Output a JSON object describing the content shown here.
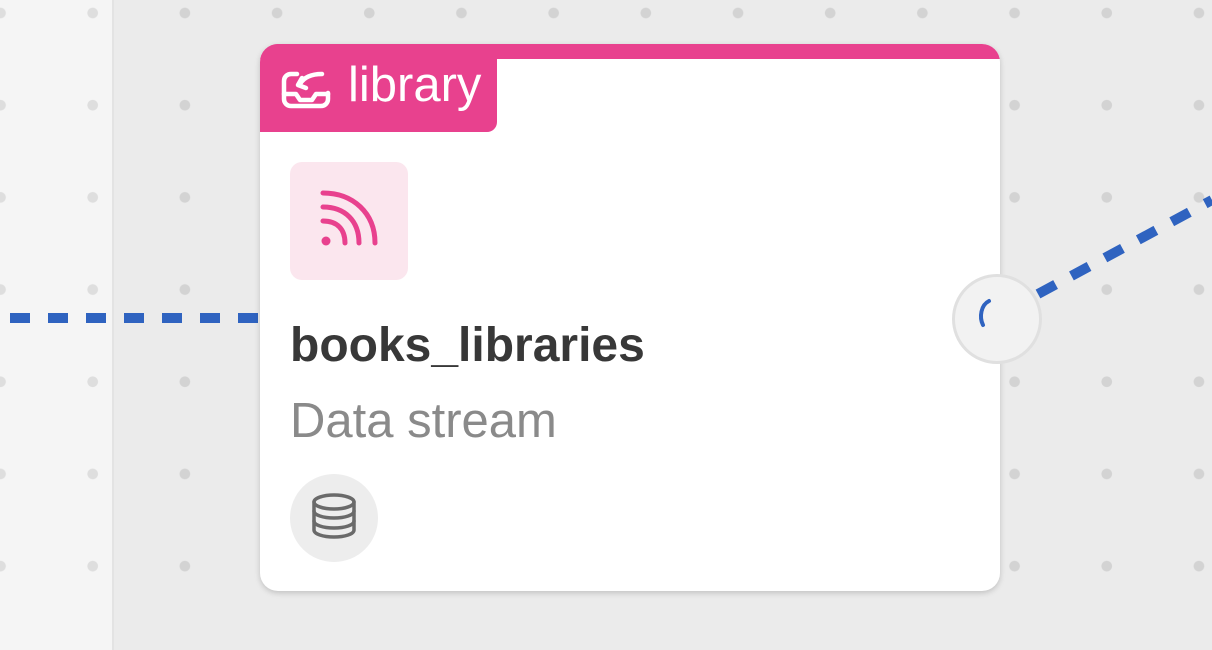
{
  "node": {
    "type_label": "library",
    "type_icon": "import-tray-icon",
    "source_icon": "rss-feed-icon",
    "title": "books_libraries",
    "subtitle": "Data stream",
    "storage_icon": "database-icon",
    "status_icon": "loading-spinner-icon"
  },
  "colors": {
    "accent": "#e8418e",
    "accent_tint": "#fbe6ee",
    "edge": "#2f63c0",
    "title": "#383838",
    "subtitle": "#8a8a8a",
    "canvas": "#ebebeb",
    "card": "#ffffff"
  }
}
